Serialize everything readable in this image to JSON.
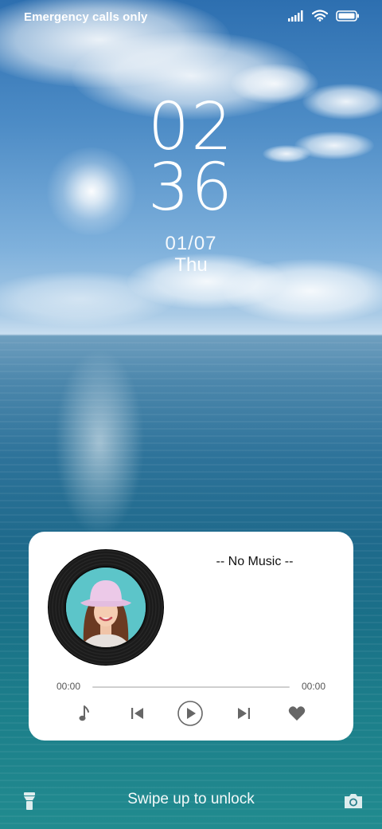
{
  "status_bar": {
    "carrier_text": "Emergency calls only",
    "icons": [
      "signal-icon",
      "wifi-icon",
      "battery-icon"
    ]
  },
  "clock": {
    "hour": "02",
    "minute": "36",
    "date": "01/07",
    "weekday": "Thu"
  },
  "music_widget": {
    "song_title": "-- No Music --",
    "elapsed": "00:00",
    "duration": "00:00",
    "progress": 0,
    "controls": [
      "music-note-icon",
      "previous-icon",
      "play-icon",
      "next-icon",
      "heart-icon"
    ]
  },
  "bottom_bar": {
    "unlock_text": "Swipe up to unlock",
    "left_icon": "flashlight-icon",
    "right_icon": "camera-icon"
  },
  "colors": {
    "card_background": "#ffffff",
    "control_icon": "#666666",
    "sea": "#1f6a8c"
  }
}
